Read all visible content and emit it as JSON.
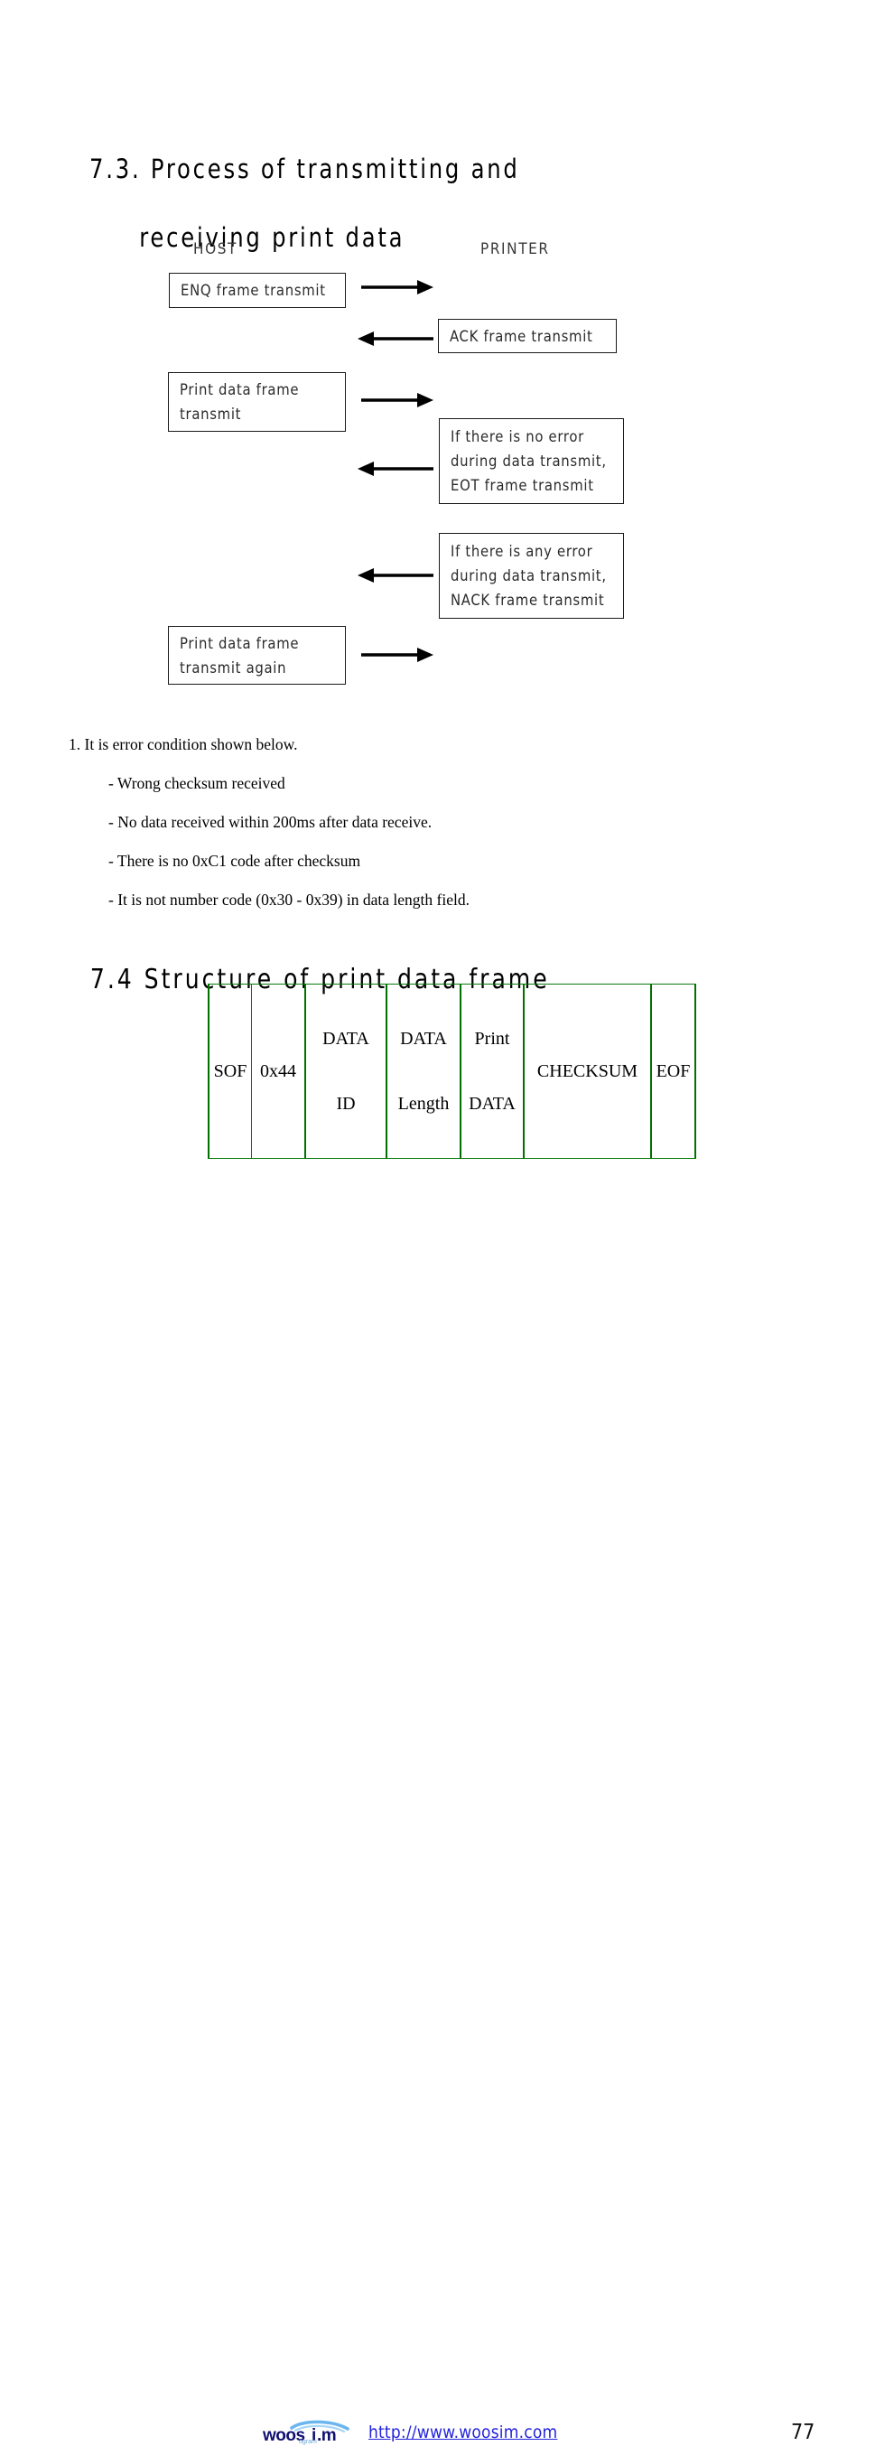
{
  "sections": {
    "s73": {
      "line1": "7.3. Process of transmitting and",
      "line2": "receiving print data"
    },
    "s74": {
      "title": "7.4 Structure of print data frame"
    }
  },
  "diagram": {
    "columns": {
      "host": "HOST",
      "printer": "PRINTER"
    },
    "boxes": {
      "enq": "ENQ frame transmit",
      "ack": "ACK frame transmit",
      "print_data_1": "Print data frame",
      "print_data_2": "transmit",
      "eot_1": "If there is no error",
      "eot_2": "during data transmit,",
      "eot_3": "EOT frame transmit",
      "nack_1": "If there is any error",
      "nack_2": "during data transmit,",
      "nack_3": "NACK frame transmit",
      "retry_1": "Print data frame",
      "retry_2": "transmit again"
    },
    "arrows": [
      {
        "name": "host-to-printer-enq",
        "direction": "right"
      },
      {
        "name": "printer-to-host-ack",
        "direction": "left"
      },
      {
        "name": "host-to-printer-printdata",
        "direction": "right"
      },
      {
        "name": "printer-to-host-eot",
        "direction": "left"
      },
      {
        "name": "printer-to-host-nack",
        "direction": "left"
      },
      {
        "name": "host-to-printer-retry",
        "direction": "right"
      }
    ]
  },
  "error_notes": {
    "intro": "1. It is error condition shown below.",
    "items": [
      "- Wrong checksum received",
      "- No data received within 200ms after data receive.",
      "- There is no 0xC1 code after checksum",
      "- It is not number code (0x30 - 0x39) in data length field."
    ]
  },
  "frame_table": {
    "border_color": "#007000",
    "cells": [
      {
        "name": "sof",
        "top": "SOF",
        "bottom": ""
      },
      {
        "name": "0x44",
        "top": "0x44",
        "bottom": ""
      },
      {
        "name": "data-id",
        "top": "DATA",
        "bottom": "ID"
      },
      {
        "name": "data-length",
        "top": "DATA",
        "bottom": "Length"
      },
      {
        "name": "print-data",
        "top": "Print",
        "bottom": "DATA"
      },
      {
        "name": "checksum",
        "top": "CHECKSUM",
        "bottom": ""
      },
      {
        "name": "eof",
        "top": "EOF",
        "bottom": ""
      }
    ]
  },
  "footer": {
    "logo_text": "woosim",
    "url": "http://www.woosim.com",
    "page_number": "77",
    "url_color": "#2222dd",
    "logo_color": "#101070",
    "logo_swoosh_color": "#6cb6f0"
  }
}
